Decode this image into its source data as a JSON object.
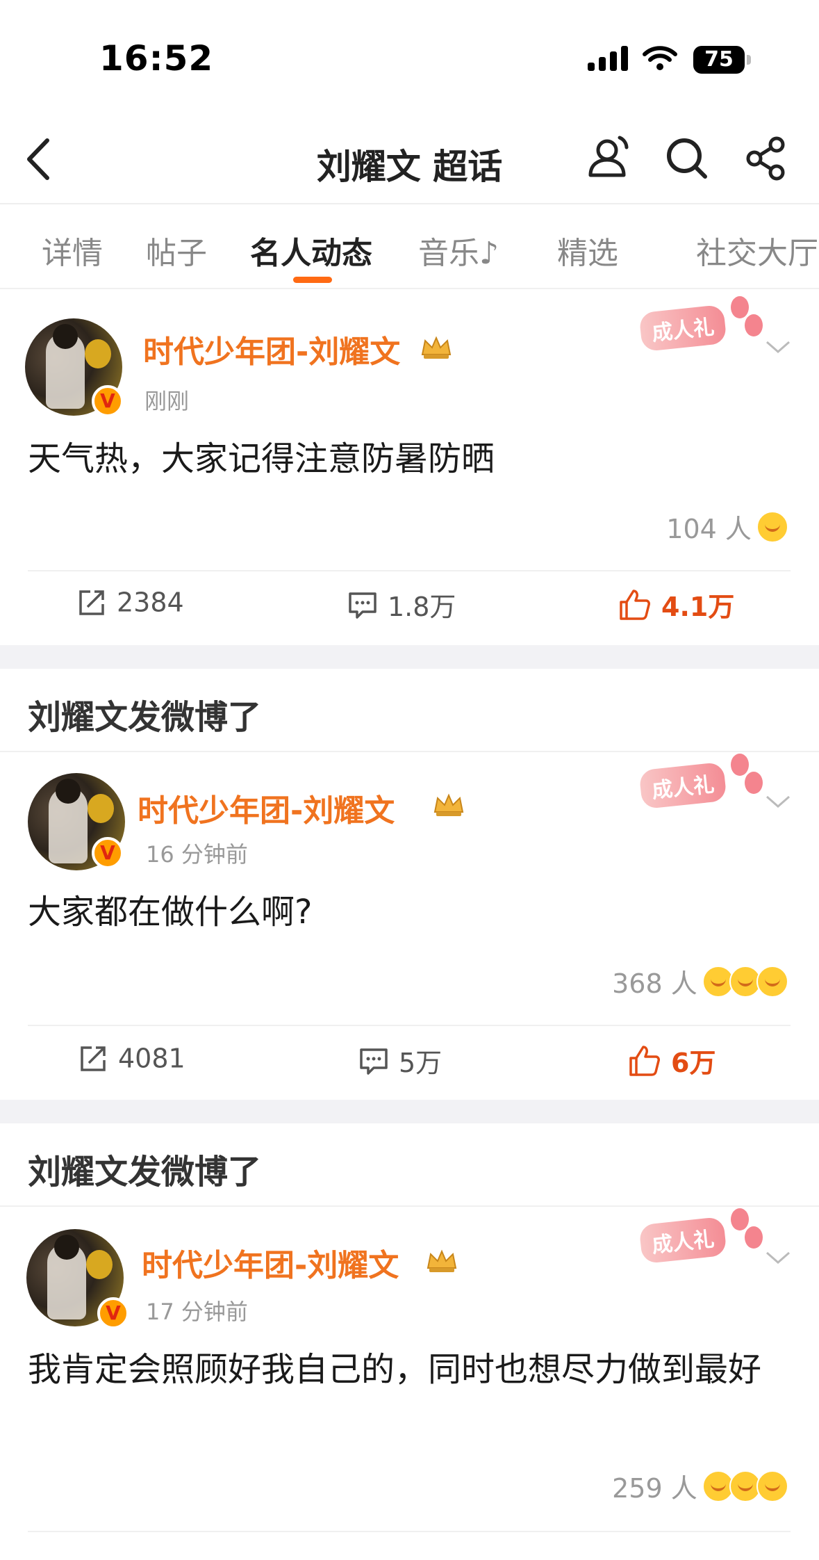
{
  "status_bar": {
    "time": "16:52",
    "battery": "75"
  },
  "nav": {
    "title": "刘耀文 超话",
    "icons": [
      "back-icon",
      "people-icon",
      "search-icon",
      "share-icon"
    ]
  },
  "tabs": [
    {
      "label": "详情"
    },
    {
      "label": "帖子"
    },
    {
      "label": "名人动态",
      "active": true
    },
    {
      "label": "音乐♪"
    },
    {
      "label": "精选"
    },
    {
      "label": "社交大厅"
    }
  ],
  "section_title": "刘耀文发微博了",
  "ribbon_label": "成人礼",
  "colors": {
    "accent": "#ff6a13",
    "username": "#f0731f",
    "like": "#e34c13"
  },
  "posts": [
    {
      "author": "时代少年团-刘耀文",
      "time": "刚刚",
      "text": "天气热，大家记得注意防暑防晒",
      "likes_people": "104 人",
      "reposts": "2384",
      "comments": "1.8万",
      "likes": "4.1万"
    },
    {
      "author": "时代少年团-刘耀文",
      "time": "16 分钟前",
      "text": "大家都在做什么啊?",
      "likes_people": "368 人",
      "reposts": "4081",
      "comments": "5万",
      "likes": "6万"
    },
    {
      "author": "时代少年团-刘耀文",
      "time": "17 分钟前",
      "text": "我肯定会照顾好我自己的，同时也想尽力做到最好",
      "likes_people": "259 人"
    }
  ]
}
